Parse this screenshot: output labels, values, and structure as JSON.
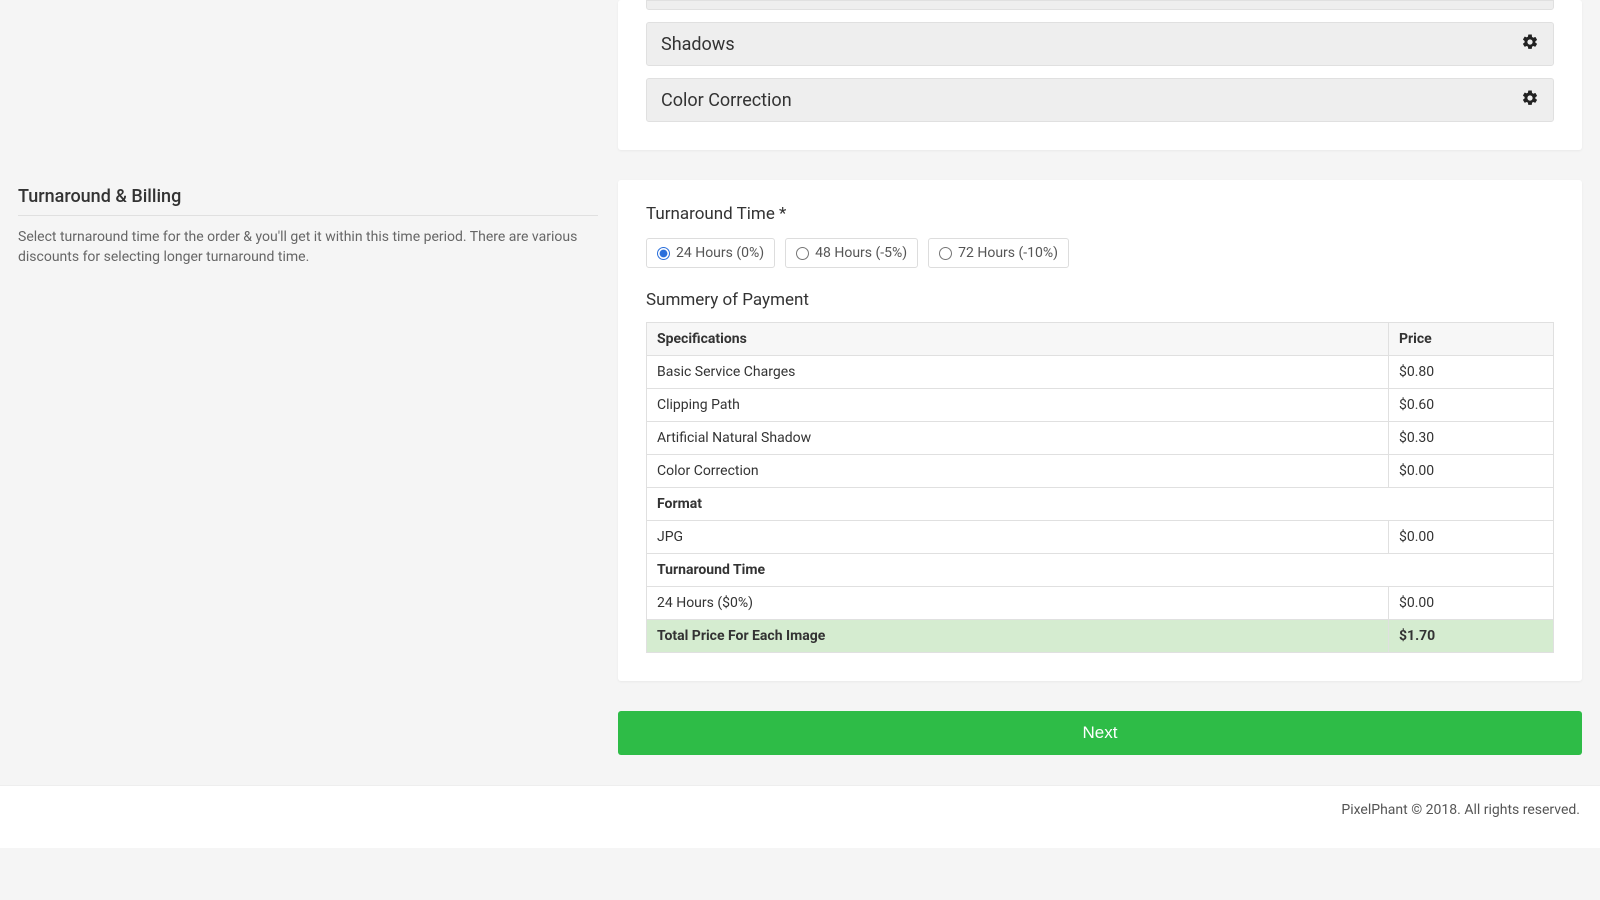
{
  "left": {
    "title": "Turnaround & Billing",
    "description": "Select turnaround time for the order & you'll get it within this time period. There are various discounts for selecting longer turnaround time."
  },
  "accordions": {
    "shadows": "Shadows",
    "color_correction": "Color Correction"
  },
  "turnaround": {
    "heading": "Turnaround Time *",
    "options": {
      "opt24": "24 Hours (0%)",
      "opt48": "48 Hours (-5%)",
      "opt72": "72 Hours (-10%)"
    },
    "selected": "24"
  },
  "summary": {
    "heading": "Summery of Payment",
    "headers": {
      "spec": "Specifications",
      "price": "Price"
    },
    "rows": {
      "basic": {
        "label": "Basic Service Charges",
        "price": "$0.80"
      },
      "clipping": {
        "label": "Clipping Path",
        "price": "$0.60"
      },
      "shadow": {
        "label": "Artificial Natural Shadow",
        "price": "$0.30"
      },
      "color": {
        "label": "Color Correction",
        "price": "$0.00"
      },
      "format_header": "Format",
      "jpg": {
        "label": "JPG",
        "price": "$0.00"
      },
      "turnaround_header": "Turnaround Time",
      "tat": {
        "label": "24 Hours ($0%)",
        "price": "$0.00"
      },
      "total": {
        "label": "Total Price For Each Image",
        "price": "$1.70"
      }
    }
  },
  "next_label": "Next",
  "footer": "PixelPhant © 2018. All rights reserved."
}
